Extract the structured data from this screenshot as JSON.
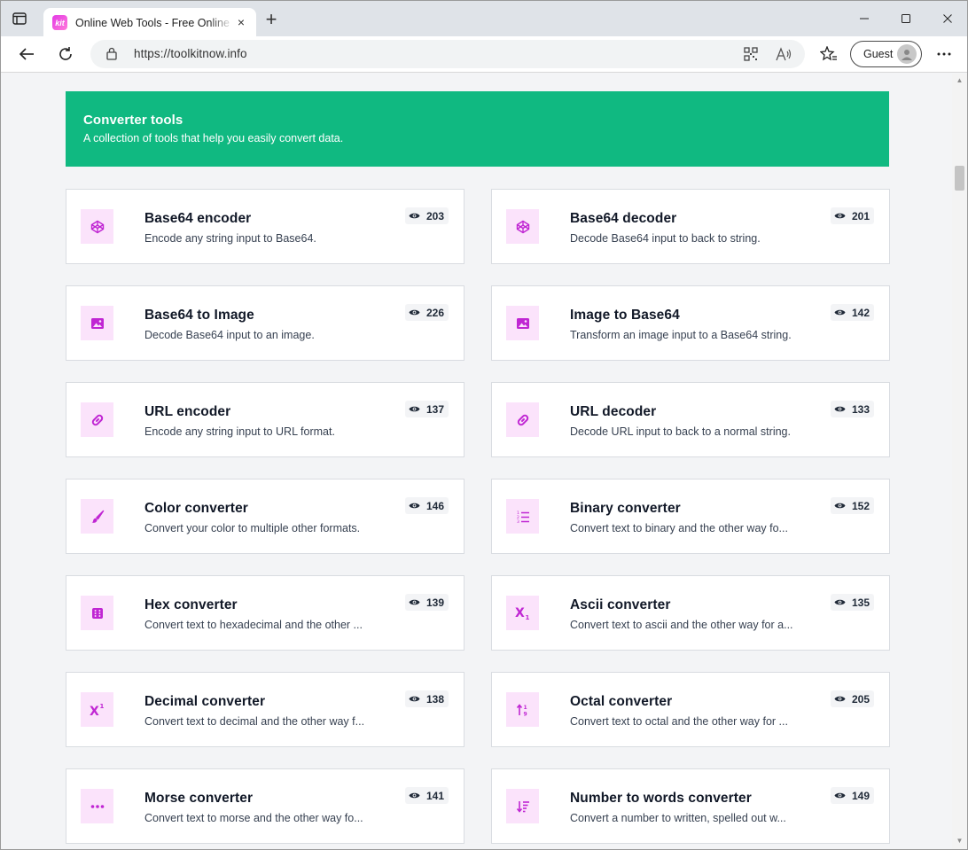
{
  "browser": {
    "tab_title": "Online Web Tools - Free Online Tools",
    "favicon_text": "kit",
    "url": "https://toolkitnow.info",
    "profile_label": "Guest",
    "icons": [
      "tab-actions-icon",
      "close-icon",
      "plus-icon",
      "minimize-icon",
      "maximize-icon",
      "close-window-icon",
      "back-arrow-icon",
      "refresh-icon",
      "lock-icon",
      "qr-code-icon",
      "read-aloud-icon",
      "favorites-star-icon",
      "more-dots-icon"
    ]
  },
  "section": {
    "title": "Converter tools",
    "subtitle": "A collection of tools that help you easily convert data.",
    "accent_color": "#10b981",
    "icon_color": "#c026d3",
    "icon_bg_color": "#fbe3fb"
  },
  "tools": [
    {
      "title": "Base64 encoder",
      "desc": "Encode any string input to Base64.",
      "views": "203",
      "icon": "codepen-icon"
    },
    {
      "title": "Base64 decoder",
      "desc": "Decode Base64 input to back to string.",
      "views": "201",
      "icon": "codepen-icon"
    },
    {
      "title": "Base64 to Image",
      "desc": "Decode Base64 input to an image.",
      "views": "226",
      "icon": "image-icon"
    },
    {
      "title": "Image to Base64",
      "desc": "Transform an image input to a Base64 string.",
      "views": "142",
      "icon": "image-icon"
    },
    {
      "title": "URL encoder",
      "desc": "Encode any string input to URL format.",
      "views": "137",
      "icon": "link-icon"
    },
    {
      "title": "URL decoder",
      "desc": "Decode URL input to back to a normal string.",
      "views": "133",
      "icon": "link-icon"
    },
    {
      "title": "Color converter",
      "desc": "Convert your color to multiple other formats.",
      "views": "146",
      "icon": "paintbrush-icon"
    },
    {
      "title": "Binary converter",
      "desc": "Convert text to binary and the other way fo...",
      "views": "152",
      "icon": "numbered-list-icon"
    },
    {
      "title": "Hex converter",
      "desc": "Convert text to hexadecimal and the other ...",
      "views": "139",
      "icon": "dice-six-icon"
    },
    {
      "title": "Ascii converter",
      "desc": "Convert text to ascii and the other way for a...",
      "views": "135",
      "icon": "subscript-icon"
    },
    {
      "title": "Decimal converter",
      "desc": "Convert text to decimal and the other way f...",
      "views": "138",
      "icon": "superscript-icon"
    },
    {
      "title": "Octal converter",
      "desc": "Convert text to octal and the other way for ...",
      "views": "205",
      "icon": "sort-numeric-icon"
    },
    {
      "title": "Morse converter",
      "desc": "Convert text to morse and the other way fo...",
      "views": "141",
      "icon": "ellipsis-icon"
    },
    {
      "title": "Number to words converter",
      "desc": "Convert a number to written, spelled out w...",
      "views": "149",
      "icon": "sort-descending-icon"
    }
  ]
}
